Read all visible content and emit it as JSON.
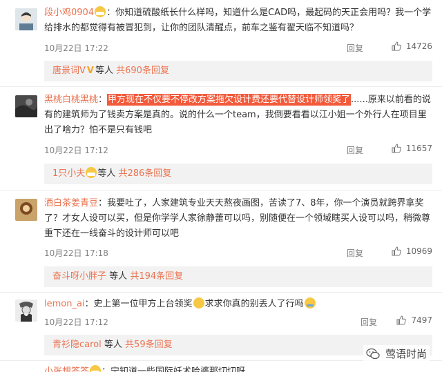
{
  "comments": [
    {
      "username": "段小鸡0904",
      "text_segments": [
        "：你知道硫酸纸长什么样吗，知道什么是CAD吗，最起码的天正会用吗？我一个学给排水的都觉得有被冒犯到，让你的团队清醒点，前车之鉴有翟天临不知道吗？"
      ],
      "time": "10月22日 17:22",
      "reply_label": "回复",
      "likes": "14726",
      "sub": {
        "name": "唐景词V",
        "badge": "V",
        "mid": "等人",
        "count": "共690条回复"
      }
    },
    {
      "username": "黑桃白桃黑桃",
      "colon": "：",
      "highlight": "甲方现在不仅要不停改方案拖欠设计费还要代替设计师领奖了",
      "rest": "......原来以前看的说有的建筑师为了钱卖方案是真的。说的什么一个team，我倒要看看以江小姐一个外行人在项目里出了啥力？怕不是只有钱吧",
      "time": "10月22日 17:12",
      "reply_label": "回复",
      "likes": "11657",
      "sub": {
        "name": "1只小夫",
        "mid": "等人",
        "count": "共286条回复"
      }
    },
    {
      "username": "酒白茶姜青豆",
      "text": "：我要吐了，人家建筑专业天天熬夜画图，苦读了7、8年，你一个演员就跨界拿奖了？才女人设可以买，但是你学学人家徐静蕾可以吗，别随便在一个领域瞎买人设可以吗，稍微尊重下还在一线奋斗的设计师可以吧",
      "time": "10月22日 17:18",
      "reply_label": "回复",
      "likes": "10969",
      "sub": {
        "name": "奋斗呀小胖子",
        "mid": "等人",
        "count": "共194条回复"
      }
    },
    {
      "username": "lemon_ai",
      "text_a": "：史上第一位甲方上台领奖",
      "text_b": "求求你真的别丢人了行吗",
      "time": "10月22日 17:12",
      "reply_label": "回复",
      "likes": "7497",
      "sub": {
        "name": "青衫隐carol",
        "mid": "等人",
        "count": "共59条回复"
      }
    },
    {
      "username": "小张想答答",
      "text": "：宁知道一些国际妖术哈婆那切切呀"
    }
  ],
  "watermark": "莺语时尚",
  "colors": {
    "username": "#eb7350",
    "highlight": "#f25a3b",
    "subbg": "#f2f2f2"
  },
  "icons": [
    "thumbs-up-icon",
    "emoji-mask-icon",
    "verified-v-icon",
    "wechat-watermark-icon"
  ]
}
